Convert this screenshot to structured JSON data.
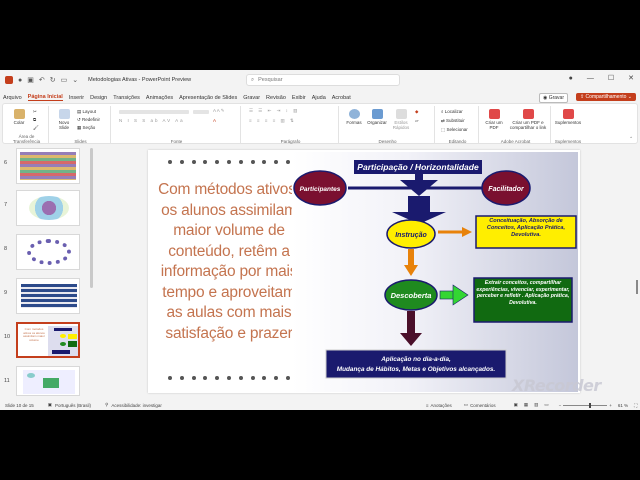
{
  "titlebar": {
    "doc_title": "Metodologias Ativas - PowerPoint Preview",
    "search_placeholder": "Pesquisar"
  },
  "menu": {
    "tabs": [
      "Arquivo",
      "Página Inicial",
      "Inserir",
      "Design",
      "Transições",
      "Animações",
      "Apresentação de Slides",
      "Gravar",
      "Revisão",
      "Exibir",
      "Ajuda",
      "Acrobat"
    ],
    "active_index": 1,
    "record_label": "Gravar",
    "share_label": "Compartilhamento"
  },
  "ribbon": {
    "clipboard": {
      "paste": "Colar",
      "label": "Área de Transferência"
    },
    "slides": {
      "new_slide": "Novo Slide",
      "layout": "Layout",
      "reset": "Redefinir",
      "section": "Seção",
      "label": "Slides"
    },
    "font": {
      "label": "Fonte"
    },
    "paragraph": {
      "label": "Parágrafo"
    },
    "drawing": {
      "shapes": "Formas",
      "arrange": "Organizar",
      "styles": "Estilos Rápidos",
      "label": "Desenho"
    },
    "editing": {
      "find": "Localizar",
      "replace": "Substituir",
      "select": "Selecionar",
      "label": "Editando"
    },
    "acrobat": {
      "create_pdf": "Criar um PDF",
      "share_pdf": "Criar um PDF e compartilhar o link",
      "label": "Adobe Acrobat"
    },
    "addins": {
      "addins": "Suplementos",
      "label": "Suplementos"
    }
  },
  "thumbnails": [
    {
      "num": "6",
      "selected": false
    },
    {
      "num": "7",
      "selected": false
    },
    {
      "num": "8",
      "selected": false
    },
    {
      "num": "9",
      "selected": false
    },
    {
      "num": "10",
      "selected": true
    },
    {
      "num": "11",
      "selected": false
    }
  ],
  "slide": {
    "left_text": "Com métodos ativos, os alunos assimilam maior volume de conteúdo, retêm a informação por mais tempo e aproveitam as aulas com mais satisfação e prazer",
    "diagram": {
      "top_bar": "Participação  /  Horizontalidade",
      "participantes": "Participantes",
      "facilitador": "Facilitador",
      "instrucao": "Instrução",
      "instrucao_box": "Conceituação, Absorção de Conceitos, Aplicação Prática, Devolutiva.",
      "descoberta": "Descoberta",
      "descoberta_box": "Extrair conceitos, compartilhar experiências, vivenciar, experimentar, perceber e refletir . Aplicação prática, Devolutiva.",
      "bottom_box_1": "Aplicação no dia-a-dia,",
      "bottom_box_2": "Mudança de Hábitos, Metas e Objetivos alcançados."
    }
  },
  "status": {
    "slide_of": "Slide 10 de 15",
    "language": "Português (Brasil)",
    "accessibility": "Acessibilidade: investigar",
    "notes": "Anotações",
    "comments": "Comentários",
    "zoom": "61 %"
  },
  "watermark": "XRecorder",
  "colors": {
    "accent": "#c43e1c",
    "slide_text": "#c4744f",
    "navy": "#1a1a6e",
    "maroon": "#7a1030",
    "yellow": "#ffee00",
    "green": "#1f8a1f",
    "orange": "#e8820a"
  }
}
